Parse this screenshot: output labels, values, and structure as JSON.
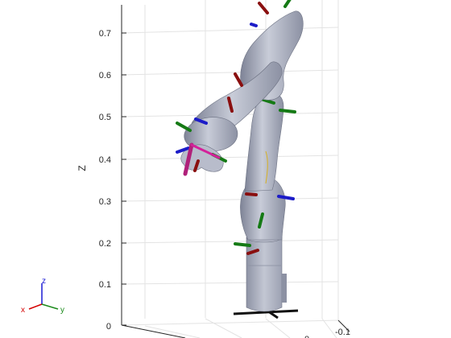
{
  "figure": {
    "axes": {
      "zlabel": "Z",
      "z_ticks": [
        "0",
        "0.1",
        "0.2",
        "0.3",
        "0.4",
        "0.5",
        "0.6",
        "0.7"
      ],
      "x_ticks_partial": [
        "-0.1",
        "0"
      ],
      "grid": true
    },
    "triad": {
      "z_label": "z",
      "x_label": "x",
      "y_label": "y",
      "colors": {
        "x": "#d40000",
        "y": "#1a8a1a",
        "z": "#1a1ad4"
      }
    },
    "robot": {
      "body_color": "#a8adbd",
      "frame_colors": {
        "x": "#8a0f0f",
        "y": "#157a15",
        "z": "#1c1cc8",
        "tool": "#d4209a"
      }
    }
  }
}
